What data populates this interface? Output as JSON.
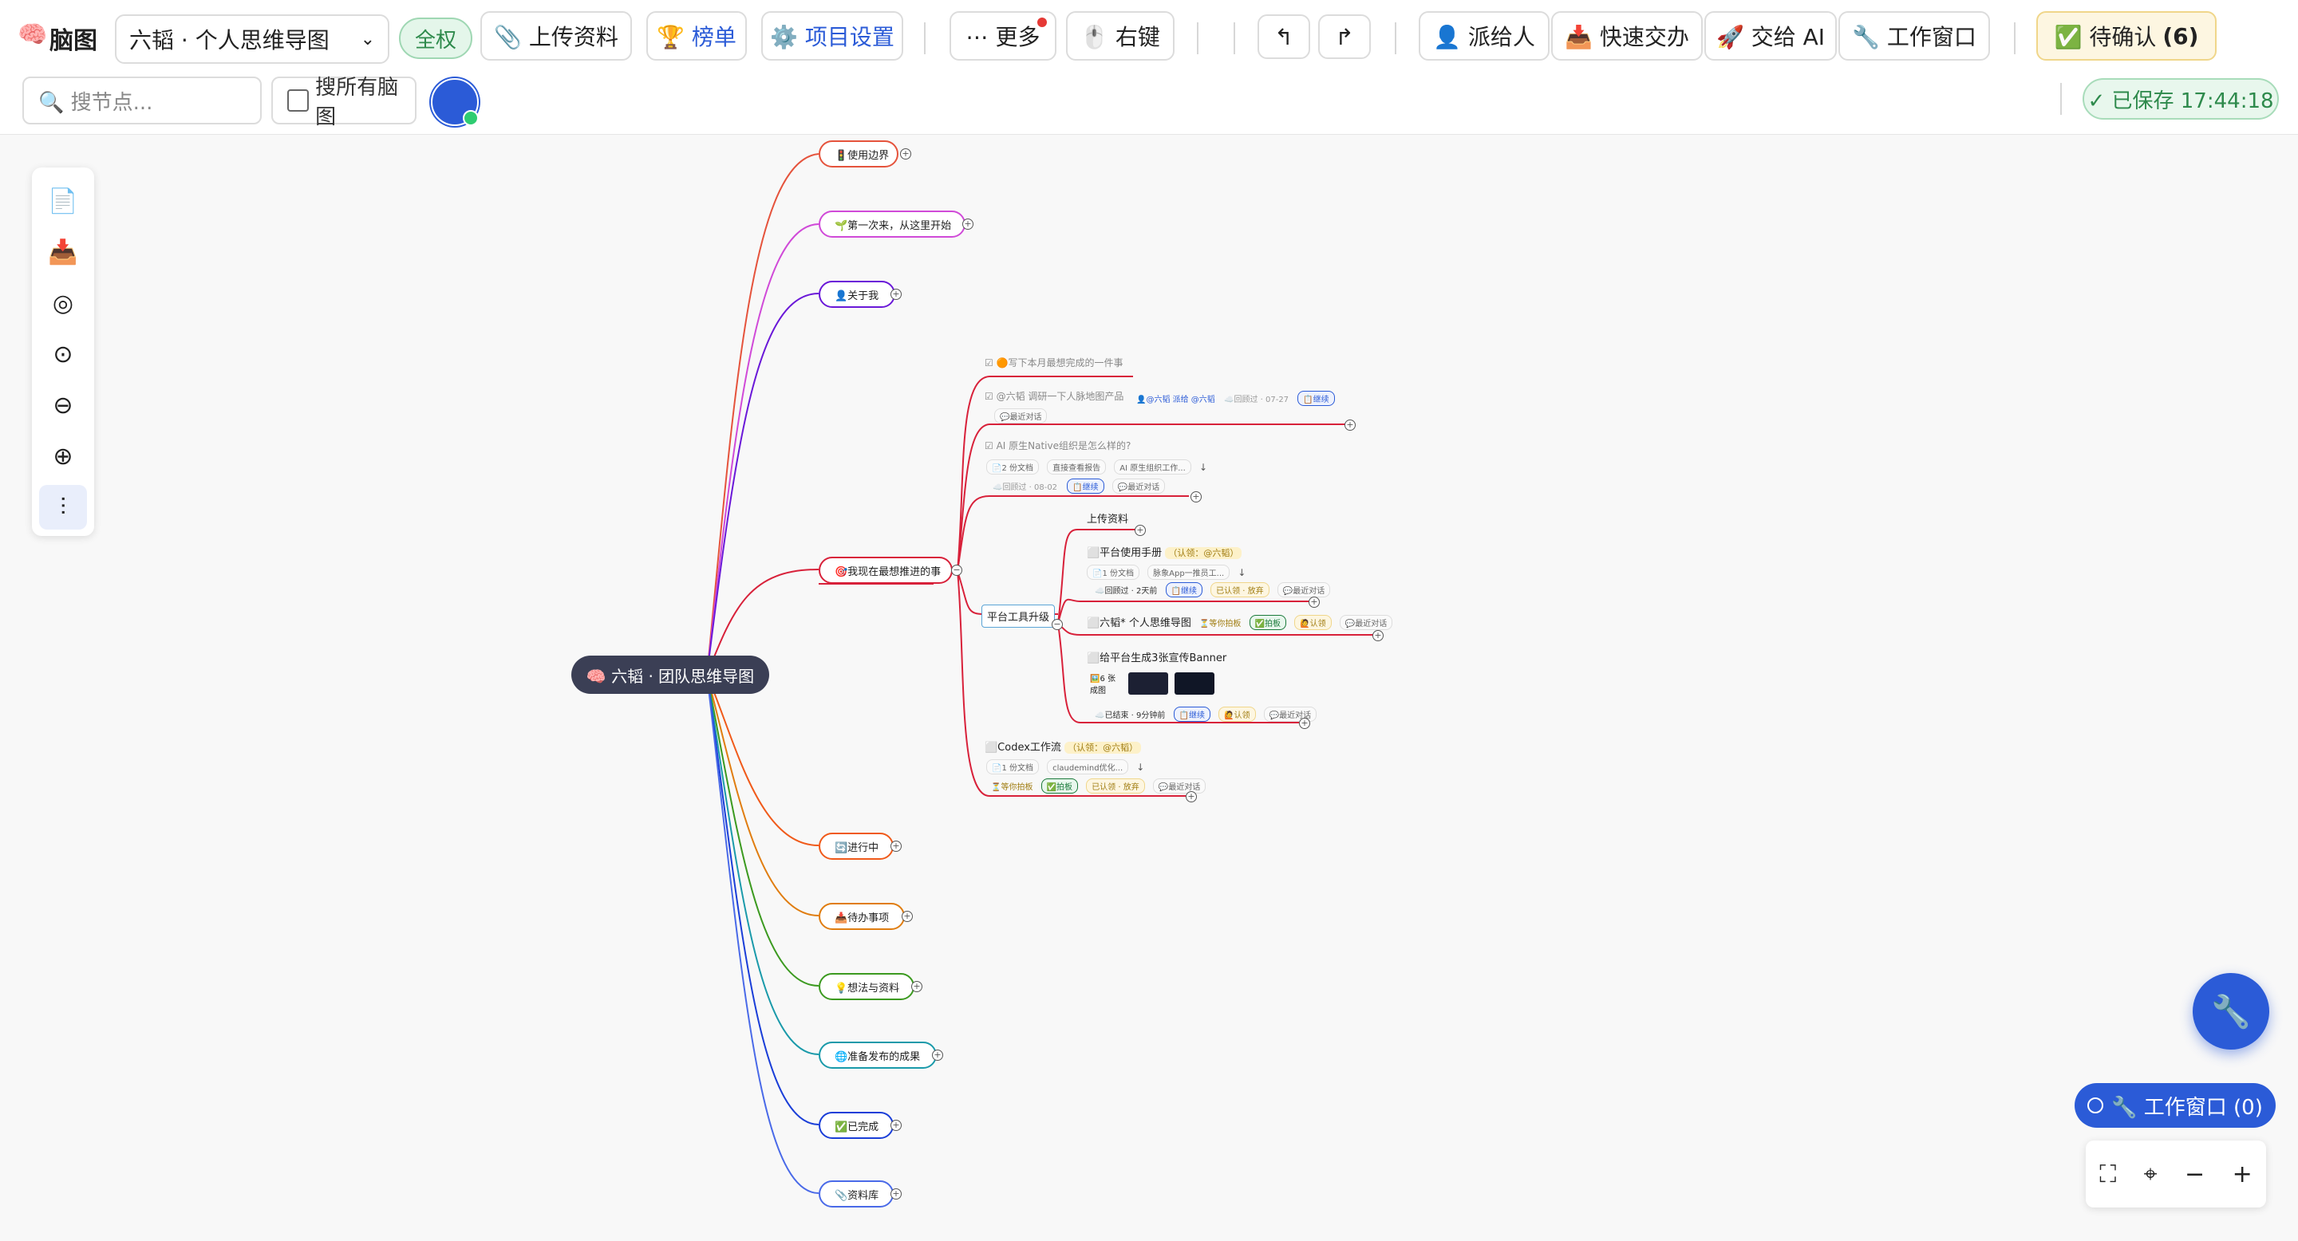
{
  "app": {
    "logo": "🧠",
    "title": "脑图"
  },
  "toolbar": {
    "map_select": "六韬 · 个人思维导图",
    "scope": "全权",
    "upload": "📎 上传资料",
    "ranking": "🏆 榜单",
    "project_settings": "⚙️ 项目设置",
    "more": "⋯ 更多",
    "right_click": "🖱️ 右键",
    "undo": "↰",
    "redo": "↱",
    "assign": "👤 派给人",
    "quick_handoff": "📥 快速交办",
    "hand_to_ai": "🚀 交给 AI",
    "work_window": "🔧 工作窗口",
    "pending_label": "✅ 待确认",
    "pending_count": "(6)"
  },
  "search": {
    "placeholder": "🔍 搜节点...",
    "all_maps_label": "搜所有脑图"
  },
  "saved": "✓ 已保存 17:44:18",
  "tools": [
    "copy-icon",
    "inbox-icon",
    "target-icon",
    "focus-icon",
    "zoom-out-icon",
    "zoom-in-icon",
    "layout-icon"
  ],
  "mindmap": {
    "root": "🧠 六韬 · 团队思维导图",
    "branches": [
      {
        "label": "🚦使用边界",
        "color": "#e5533c"
      },
      {
        "label": "🌱第一次来，从这里开始",
        "color": "#d04ad8"
      },
      {
        "label": "👤关于我",
        "color": "#6a18d8"
      },
      {
        "label": "🎯我现在最想推进的事",
        "color": "#d8213a"
      },
      {
        "label": "🔄进行中",
        "color": "#f05a1a"
      },
      {
        "label": "📥待办事项",
        "color": "#e07d10"
      },
      {
        "label": "💡想法与资料",
        "color": "#3c9a20"
      },
      {
        "label": "🌐准备发布的成果",
        "color": "#1a9aaa"
      },
      {
        "label": "✅已完成",
        "color": "#1a3ed8"
      },
      {
        "label": "📎资料库",
        "color": "#4a6ae8"
      }
    ],
    "focus": {
      "t1": "☑ 🟠写下本月最想完成的一件事",
      "t2": "☑ @六韬 调研一下人脉地图产品",
      "t2_meta": "👤@六韬 派给 @六韬",
      "t2_date": "☁️回顾过 · 07-27",
      "t2_tag": "📋继续",
      "t2_tag2": "💬最近对话",
      "t3": "☑ AI 原生Native组织是怎么样的?",
      "t3_docs": "📄2 份文档",
      "t3_doc1": "直接查看报告",
      "t3_doc2": "AI 原生组织工作...",
      "t3_date": "☁️回顾过 · 08-02",
      "t3_tag": "📋继续",
      "t3_tag2": "💬最近对话",
      "platform": "平台工具升级",
      "upload": "上传资料",
      "manual": "⬜平台使用手册",
      "manual_claim": "（认领：@六韬）",
      "manual_docs": "📄1 份文档",
      "manual_doc1": "脉象App一推员工...",
      "manual_date": "☁️回顾过 · 2天前",
      "manual_tag": "📋继续",
      "manual_tag2": "已认领 · 放弃",
      "manual_tag3": "💬最近对话",
      "map": "⬜六韬* 个人思维导图",
      "map_wait": "⏳等你拍板",
      "map_tag": "✅拍板",
      "map_tag2": "🙋认领",
      "map_tag3": "💬最近对话",
      "banner": "⬜给平台生成3张宣传Banner",
      "banner_results": "🖼️6 张成图",
      "banner_date": "☁️已结束 · 9分钟前",
      "banner_tag": "📋继续",
      "banner_tag2": "🙋认领",
      "banner_tag3": "💬最近对话",
      "codex": "⬜Codex工作流",
      "codex_claim": "（认领：@六韬）",
      "codex_docs": "📄1 份文档",
      "codex_doc1": "claudemind优化...",
      "codex_wait": "⏳等你拍板",
      "codex_tag": "✅拍板",
      "codex_tag2": "已认领 · 放弃",
      "codex_tag3": "💬最近对话"
    }
  },
  "floating": {
    "fab_icon": "🔧",
    "work_window": "🔧 工作窗口 (0)"
  },
  "zoom_controls": [
    "⛶",
    "⌖",
    "−",
    "+"
  ]
}
